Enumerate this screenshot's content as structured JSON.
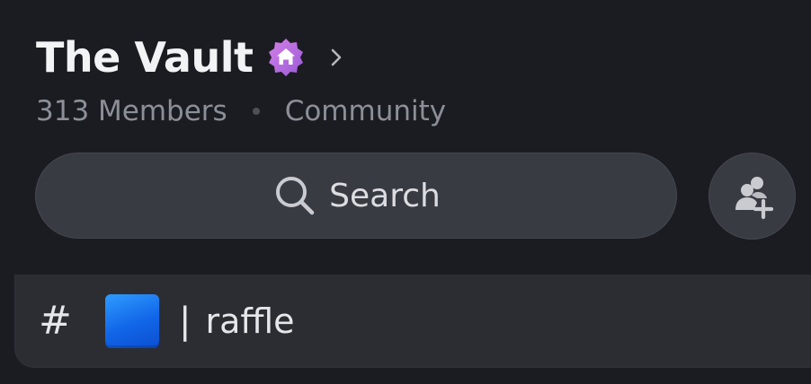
{
  "server": {
    "name": "The Vault",
    "badge_icon": "community-home-badge-icon",
    "badge_color": "#b470e0",
    "members": "313 Members",
    "type": "Community"
  },
  "search": {
    "label": "Search"
  },
  "invite": {
    "icon": "add-member-icon"
  },
  "channel": {
    "prefix": "#",
    "emoji_color": "#1677ff",
    "separator": "|",
    "name": "raffle"
  }
}
